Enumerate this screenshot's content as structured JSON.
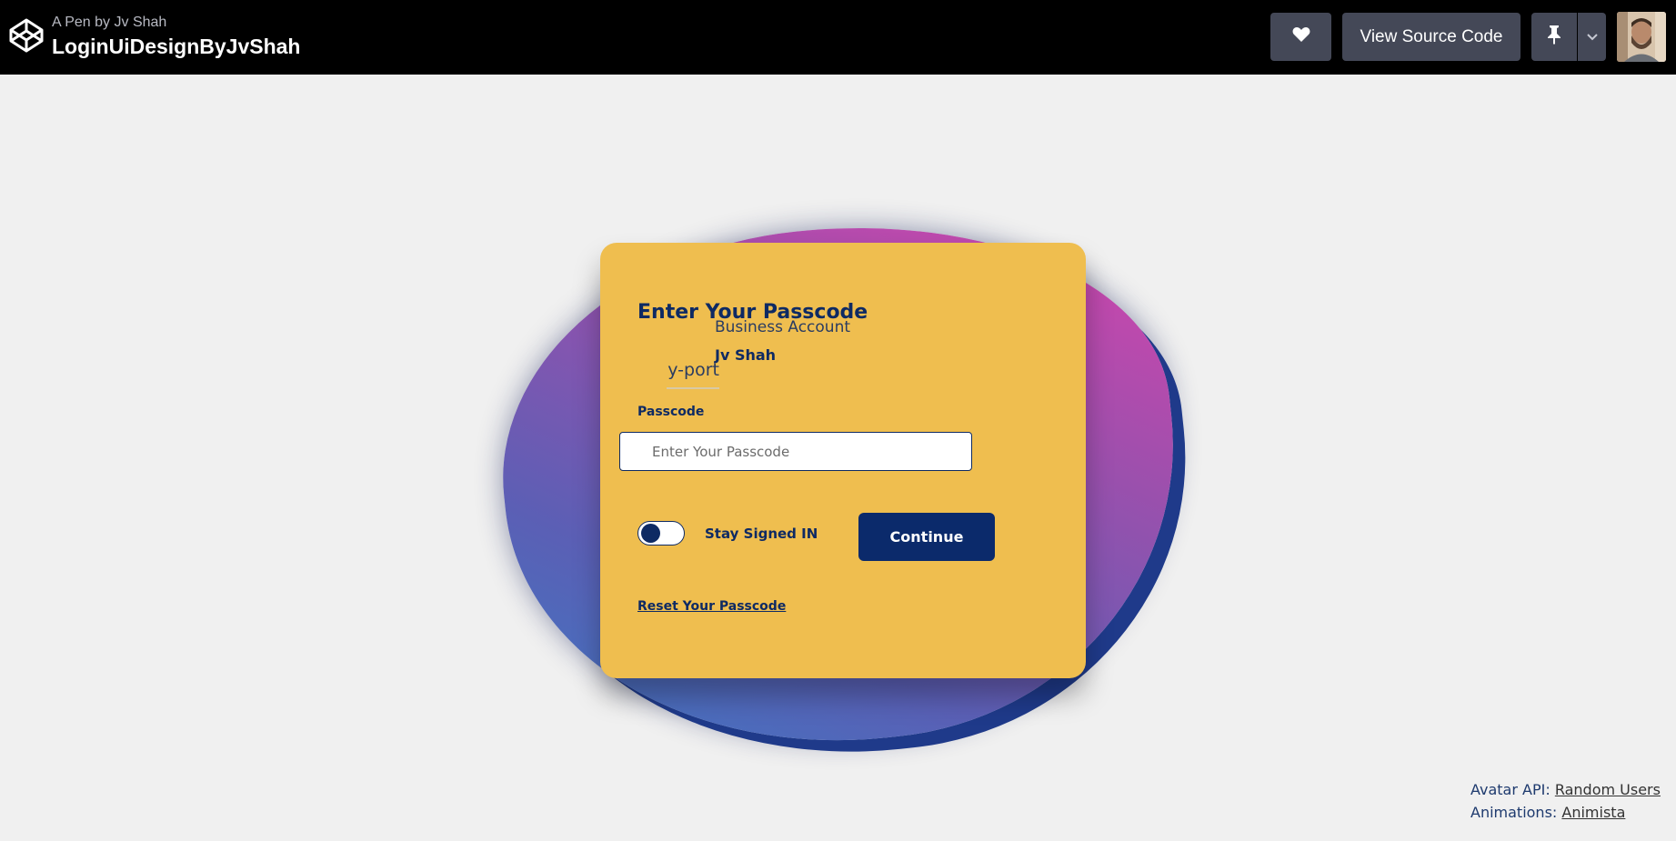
{
  "header": {
    "pen_by": "A Pen by Jv Shah",
    "title": "LoginUiDesignByJvShah",
    "heart_icon": "heart-icon",
    "view_source_label": "View Source Code",
    "pin_icon": "pin-icon",
    "caret_icon": "chevron-down-icon"
  },
  "card": {
    "title": "Enter Your Passcode",
    "account_type": "Business Account",
    "user_name": "Jv Shah",
    "avatar_alt": "ny-port",
    "passcode_label": "Passcode",
    "passcode_placeholder": "Enter Your Passcode",
    "passcode_value": "",
    "stay_signed_in_label": "Stay Signed IN",
    "stay_signed_in": false,
    "continue_label": "Continue",
    "reset_link": "Reset Your Passcode"
  },
  "credits": {
    "avatar_api_prefix": "Avatar API:",
    "avatar_api_link": "Random Users",
    "animations_prefix": "Animations:",
    "animations_link": "Animista"
  },
  "colors": {
    "card_bg": "#efbe4f",
    "primary": "#0b2a6b",
    "blob_start": "#3b79c3",
    "blob_end": "#d944ad"
  }
}
